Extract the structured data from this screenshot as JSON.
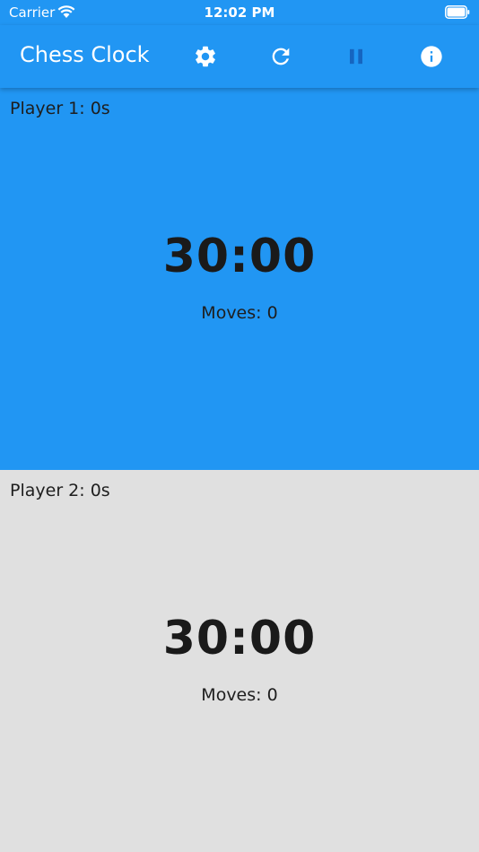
{
  "status_bar": {
    "carrier": "Carrier",
    "time": "12:02 PM"
  },
  "app_bar": {
    "title": "Chess Clock",
    "actions": [
      {
        "icon": "gear-icon"
      },
      {
        "icon": "refresh-icon"
      },
      {
        "icon": "pause-icon"
      },
      {
        "icon": "info-icon"
      }
    ]
  },
  "player1": {
    "label": "Player 1: 0s",
    "clock": "30:00",
    "moves": "Moves: 0",
    "background": "#2196f3"
  },
  "player2": {
    "label": "Player 2: 0s",
    "clock": "30:00",
    "moves": "Moves: 0",
    "background": "#e0e0e0"
  },
  "colors": {
    "accent": "#2196f3",
    "inactive": "#e0e0e0",
    "text": "#1a1a1a"
  }
}
